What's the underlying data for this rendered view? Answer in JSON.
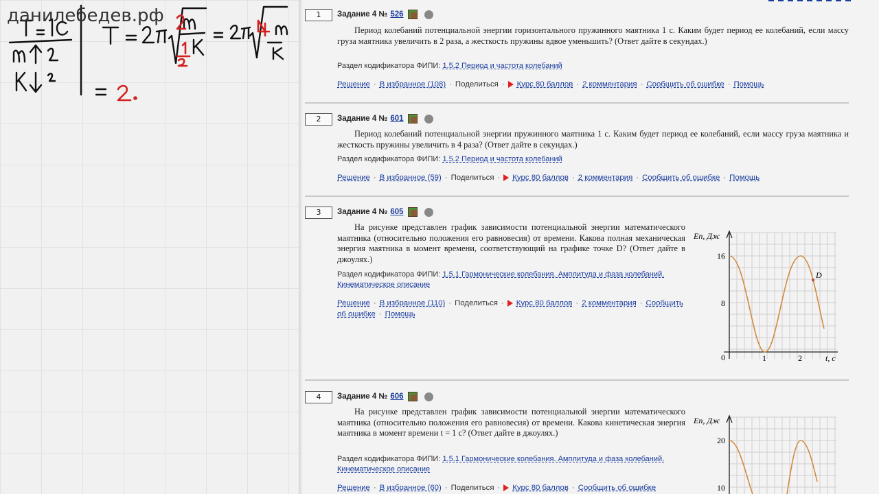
{
  "whiteboard": {
    "watermark": "данилебедев.рф",
    "notes": [
      "T = 1c",
      "m ↑ 2",
      "k ↓ 2",
      "T = 2π",
      "m",
      "k",
      "1",
      "2",
      "= 2π",
      "4m",
      "k",
      "= 2."
    ]
  },
  "tasks": [
    {
      "num": "1",
      "label": "Задание 4 №",
      "id": "526",
      "text": "Период колебаний потенциальной энергии горизонтального пружинного маятника 1 с. Каким будет период ее колебаний, если массу груза маятника увеличить в 2 раза, а жесткость пружины вдвое уменьшить? (Ответ дайте в секундах.)",
      "codifier_label": "Раздел кодификатора ФИПИ:",
      "codifier": "1.5.2 Период и частота колебаний",
      "links": {
        "solution": "Решение",
        "favorite": "В избранное (108)",
        "share": "Поделиться",
        "course": "Курс 80 баллов",
        "comments": "2 комментария",
        "report": "Сообщить об ошибке",
        "help": "Помощь"
      }
    },
    {
      "num": "2",
      "label": "Задание 4 №",
      "id": "601",
      "text": "Период колебаний потенциальной энергии пружинного маятника 1 с. Каким будет период ее колебаний, если массу груза маятника и жесткость пружины увеличить в 4 раза? (Ответ дайте в секундах.)",
      "codifier_label": "Раздел кодификатора ФИПИ:",
      "codifier": "1.5.2 Период и частота колебаний",
      "links": {
        "solution": "Решение",
        "favorite": "В избранное (59)",
        "share": "Поделиться",
        "course": "Курс 80 баллов",
        "comments": "2 комментария",
        "report": "Сообщить об ошибке",
        "help": "Помощь"
      }
    },
    {
      "num": "3",
      "label": "Задание 4 №",
      "id": "605",
      "text": "На рисунке представлен график зависимости потенциальной энергии математического маятника (относительно положения его равновесия) от времени. Какова полная механическая энергия маятника в момент времени, соответствующий на графике точке D? (Ответ дайте в джоулях.)",
      "codifier_label": "Раздел кодификатора ФИПИ:",
      "codifier": "1.5.1 Гармонические колебания. Амплитуда и фаза колебаний. Кинематическое описание",
      "links": {
        "solution": "Решение",
        "favorite": "В избранное (110)",
        "share": "Поделиться",
        "course": "Курс 80 баллов",
        "comments": "2 комментария",
        "report": "Сообщить об ошибке",
        "help": "Помощь"
      },
      "graph": {
        "ylabel": "Eп, Дж",
        "xlabel": "t, c",
        "yticks": [
          "16",
          "8",
          "0"
        ],
        "xticks": [
          "1",
          "2"
        ],
        "point": "D"
      }
    },
    {
      "num": "4",
      "label": "Задание 4 №",
      "id": "606",
      "text": "На рисунке представлен график зависимости потенциальной энергии математического маятника (относительно положения его равновесия) от времени. Какова кинетическая энергия маятника в момент времени t = 1 с? (Ответ дайте в джоулях.)",
      "codifier_label": "Раздел кодификатора ФИПИ:",
      "codifier": "1.5.1 Гармонические колебания. Амплитуда и фаза колебаний. Кинематическое описание",
      "links": {
        "solution": "Решение",
        "favorite": "В избранное (60)",
        "share": "Поделиться",
        "course": "Курс 80 баллов",
        "report": "Сообщить об ошибке"
      },
      "graph": {
        "ylabel": "Eп, Дж",
        "yticks": [
          "20",
          "10"
        ]
      }
    }
  ]
}
